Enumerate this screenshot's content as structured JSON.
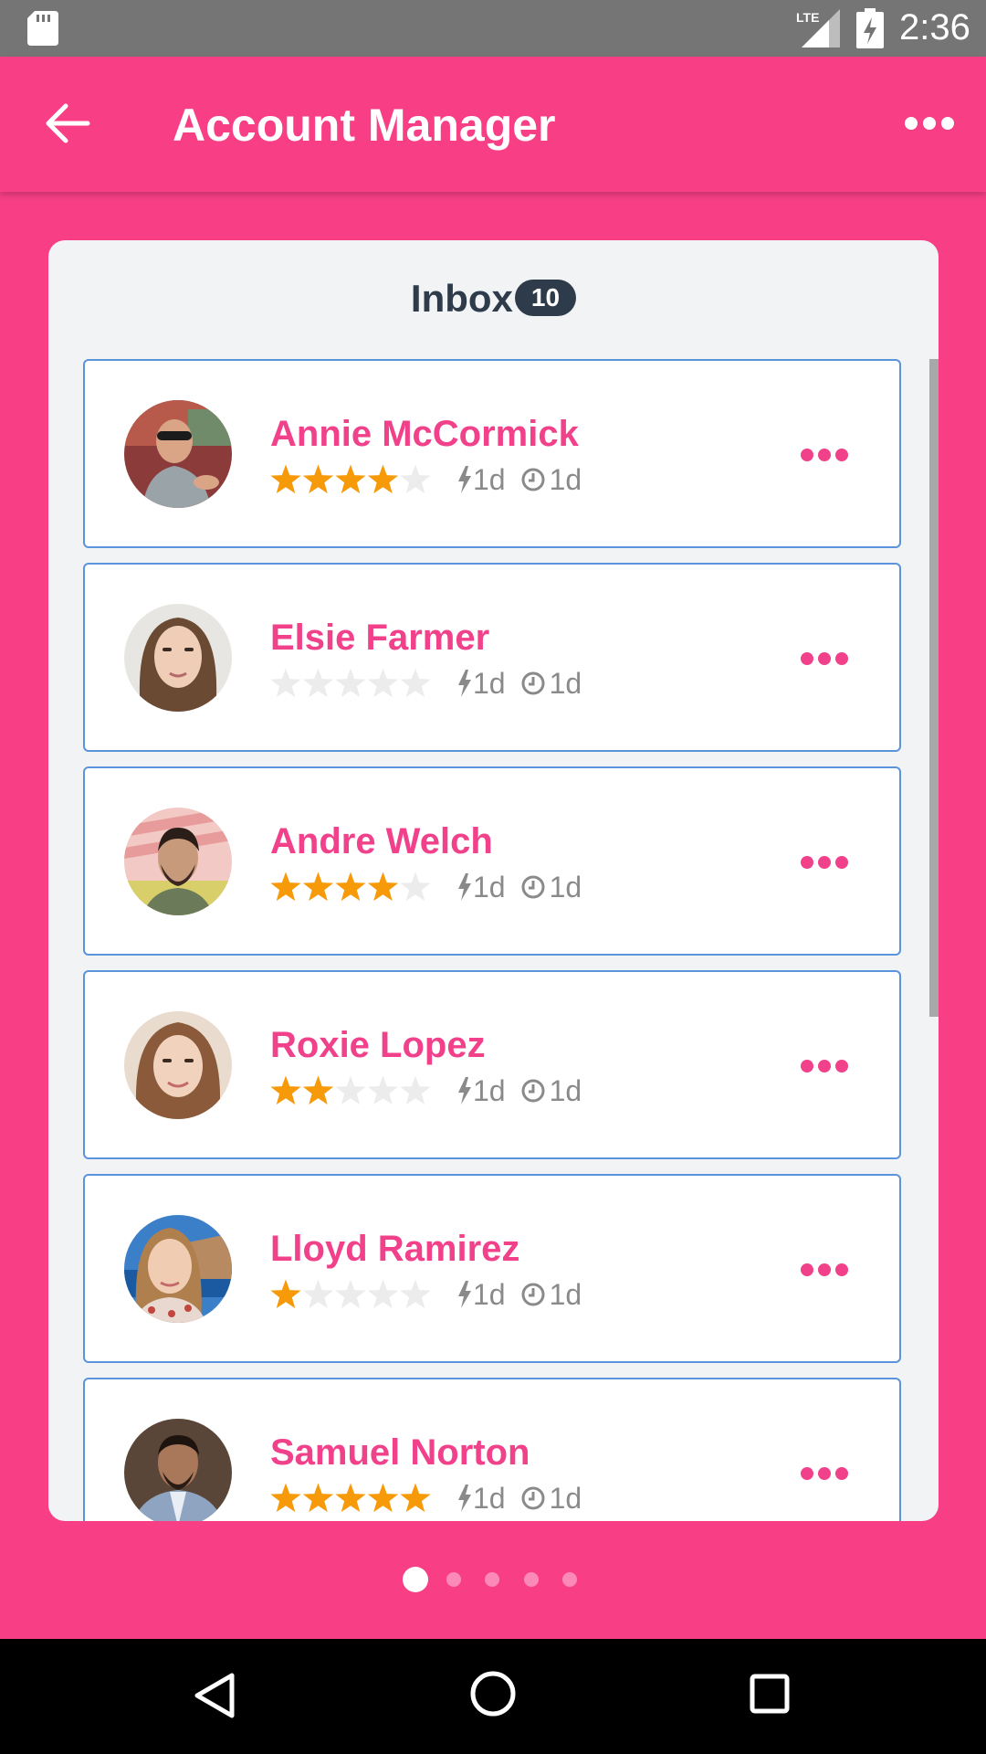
{
  "status_bar": {
    "network": "LTE",
    "time": "2:36"
  },
  "app_bar": {
    "title": "Account Manager"
  },
  "inbox": {
    "title": "Inbox",
    "count": "10"
  },
  "contacts": [
    {
      "name": "Annie McCormick",
      "rating": 4,
      "rating_max": 5,
      "activity": "1d",
      "time": "1d",
      "avatar": "woman-sunglasses"
    },
    {
      "name": "Elsie Farmer",
      "rating": 0,
      "rating_max": 5,
      "activity": "1d",
      "time": "1d",
      "avatar": "woman-long-hair"
    },
    {
      "name": "Andre Welch",
      "rating": 4,
      "rating_max": 5,
      "activity": "1d",
      "time": "1d",
      "avatar": "man-beard"
    },
    {
      "name": "Roxie Lopez",
      "rating": 2,
      "rating_max": 5,
      "activity": "1d",
      "time": "1d",
      "avatar": "woman-smiling"
    },
    {
      "name": "Lloyd Ramirez",
      "rating": 1,
      "rating_max": 5,
      "activity": "1d",
      "time": "1d",
      "avatar": "woman-sea"
    },
    {
      "name": "Samuel Norton",
      "rating": 5,
      "rating_max": 5,
      "activity": "1d",
      "time": "1d",
      "avatar": "man-suit"
    }
  ],
  "pagination": {
    "pages": 5,
    "current": 1
  },
  "colors": {
    "primary": "#f83f86",
    "name": "#f0418a",
    "star_filled": "#f79a0a",
    "star_empty": "#ececec",
    "item_border": "#5b93dd",
    "badge": "#2d3b4a"
  }
}
